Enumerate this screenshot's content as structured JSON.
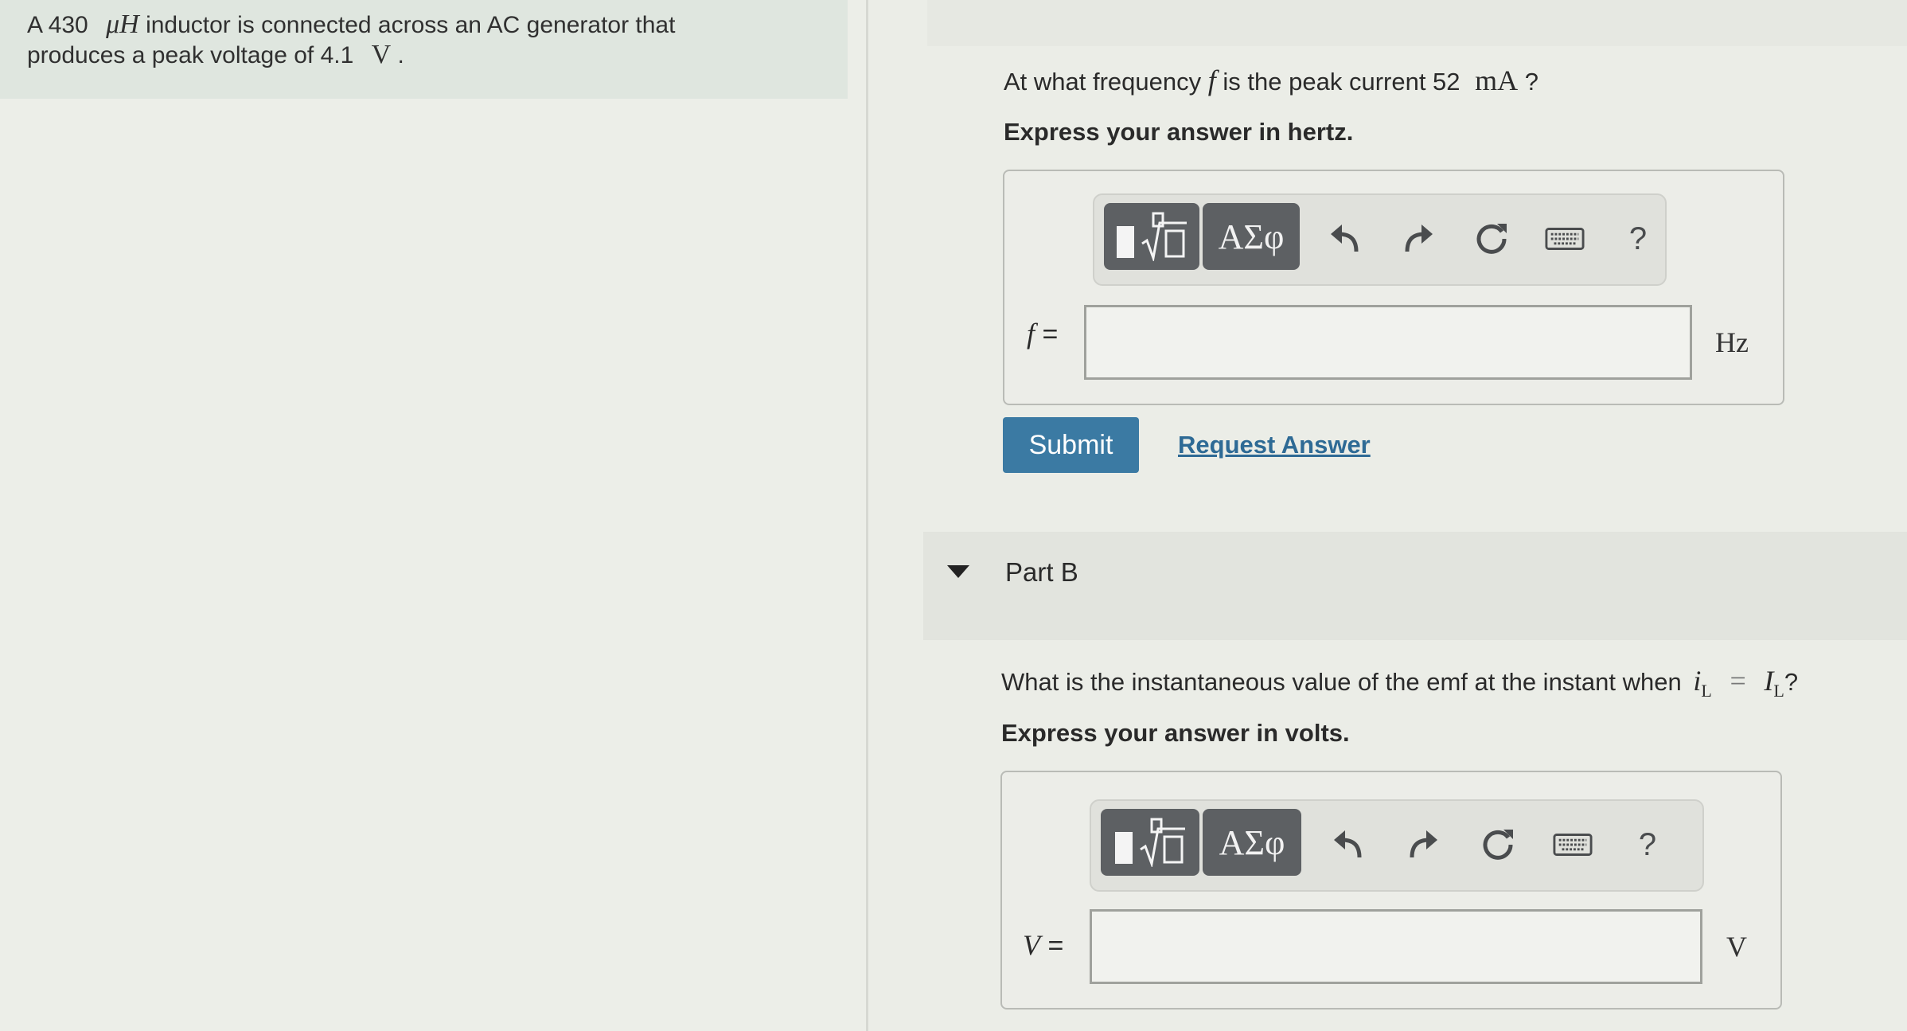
{
  "problem": {
    "line1_pre": "A 430",
    "line1_unit": "μH",
    "line1_post": "inductor is connected across an AC generator that",
    "line2_pre": "produces a peak voltage of 4.1",
    "line2_unit": "V",
    "line2_post": "."
  },
  "part_a": {
    "question_pre": "At what frequency",
    "question_var": "f",
    "question_mid": "is the peak current 52",
    "question_unit": "mA",
    "question_end": "?",
    "instruction": "Express your answer in hertz.",
    "toolbar": {
      "templates_label": "",
      "greek_label": "ΑΣφ",
      "help_label": "?"
    },
    "field_label": "f =",
    "field_value": "",
    "unit": "Hz"
  },
  "actions": {
    "submit_label": "Submit",
    "request_label": "Request Answer"
  },
  "part_b": {
    "title": "Part B",
    "question_pre": "What is the instantaneous value of the emf at the instant when",
    "question_var1": "i",
    "question_sub1": "L",
    "question_eq": "=",
    "question_var2": "I",
    "question_sub2": "L",
    "question_end": "?",
    "instruction": "Express your answer in volts.",
    "toolbar": {
      "greek_label": "ΑΣφ",
      "help_label": "?"
    },
    "field_label": "V =",
    "field_value": "",
    "unit": "V"
  },
  "colors": {
    "submit_bg": "#3b7aa3",
    "link": "#2e6a95",
    "toolbar_button": "#5d6063"
  }
}
